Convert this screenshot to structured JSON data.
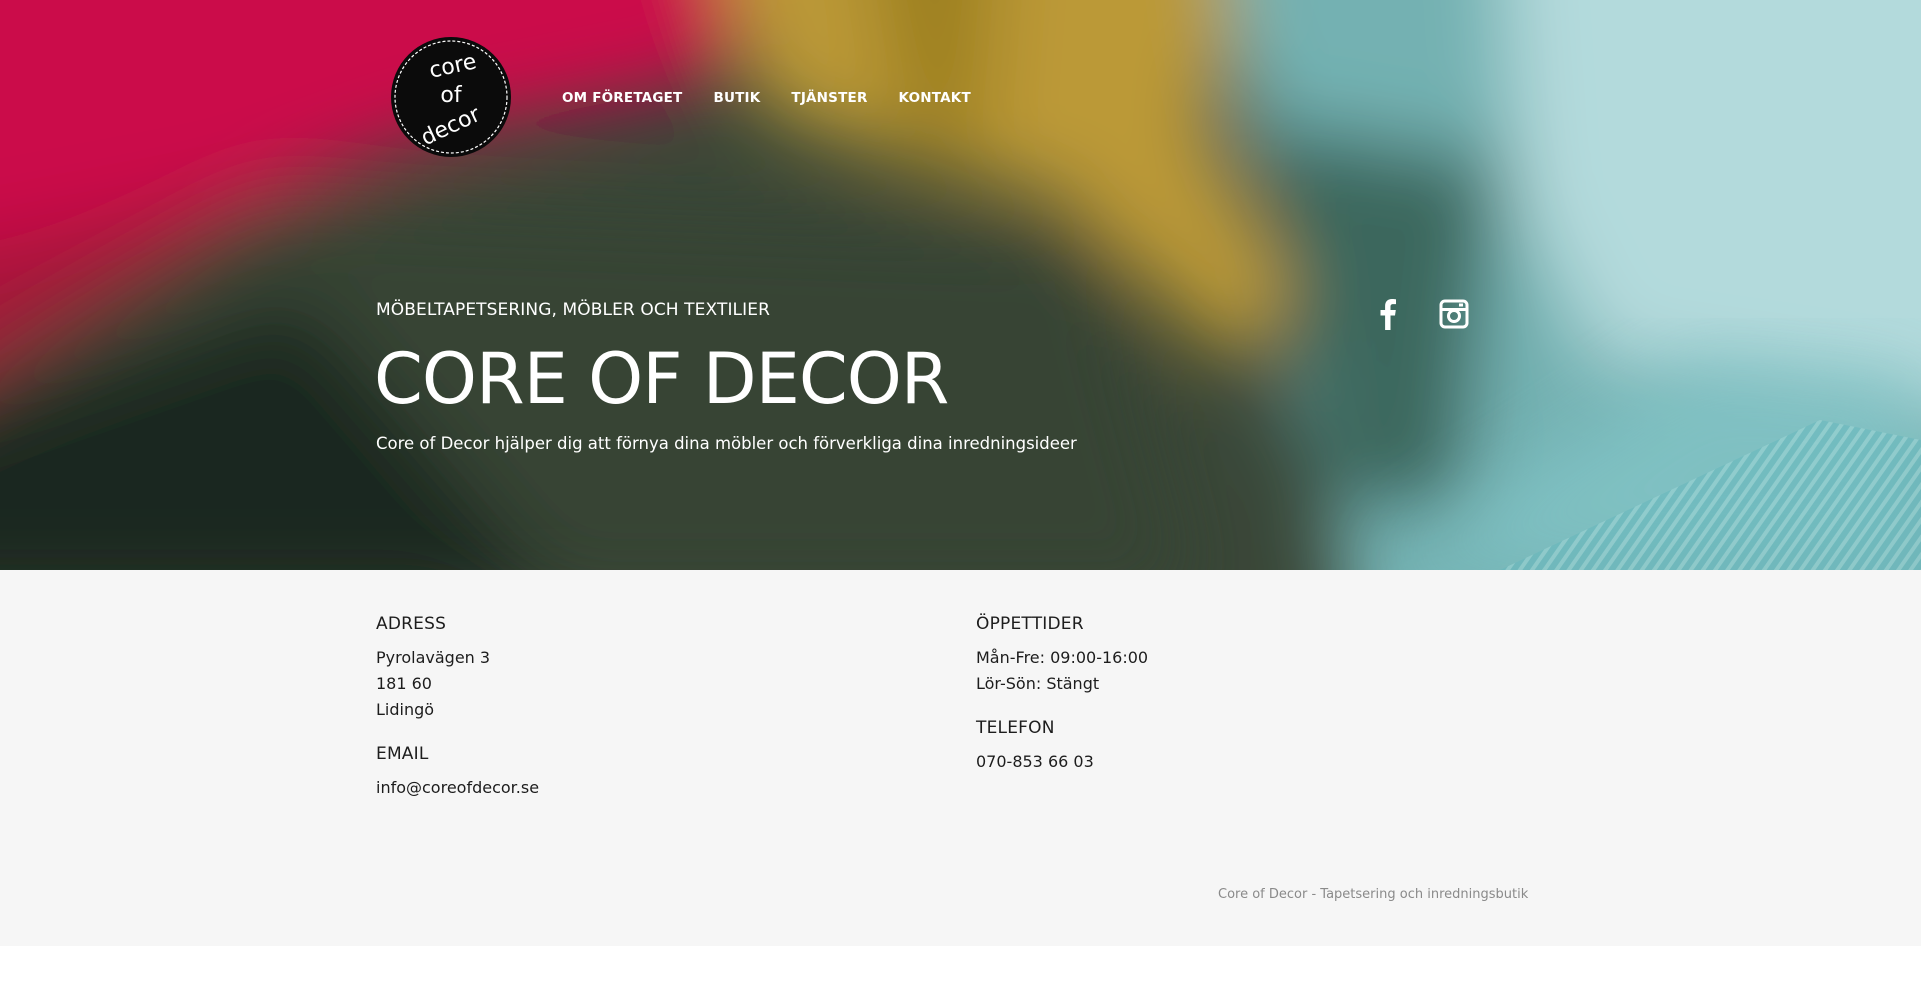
{
  "logo": {
    "line1": "core",
    "line2": "of",
    "line3": "decor"
  },
  "nav": [
    {
      "label": "OM FÖRETAGET"
    },
    {
      "label": "BUTIK"
    },
    {
      "label": "TJÄNSTER"
    },
    {
      "label": "KONTAKT"
    }
  ],
  "hero": {
    "tagline": "MÖBELTAPETSERING, MÖBLER OCH TEXTILIER",
    "title": "CORE OF DECOR",
    "description": "Core of Decor hjälper dig att förnya dina möbler och förverkliga dina inredningsideer"
  },
  "social": {
    "facebook_icon": "facebook-icon",
    "instagram_icon": "instagram-icon"
  },
  "contact": {
    "address_heading": "ADRESS",
    "address_street": "Pyrolavägen 3",
    "address_zip": "181 60",
    "address_city": "Lidingö",
    "email_heading": "EMAIL",
    "email": "info@coreofdecor.se",
    "hours_heading": "ÖPPETTIDER",
    "hours_weekdays": "Mån-Fre: 09:00-16:00",
    "hours_weekend": "Lör-Sön: Stängt",
    "phone_heading": "TELEFON",
    "phone": "070-853 66 03"
  },
  "footer": {
    "credit": "Core of Decor - Tapetsering och inredningsbutik"
  },
  "colors": {
    "magenta": "#d8104f",
    "mustard": "#c7a33a",
    "green": "#3b4a39",
    "turquoise": "#8fd4d8",
    "info_bg": "#f6f6f6"
  }
}
